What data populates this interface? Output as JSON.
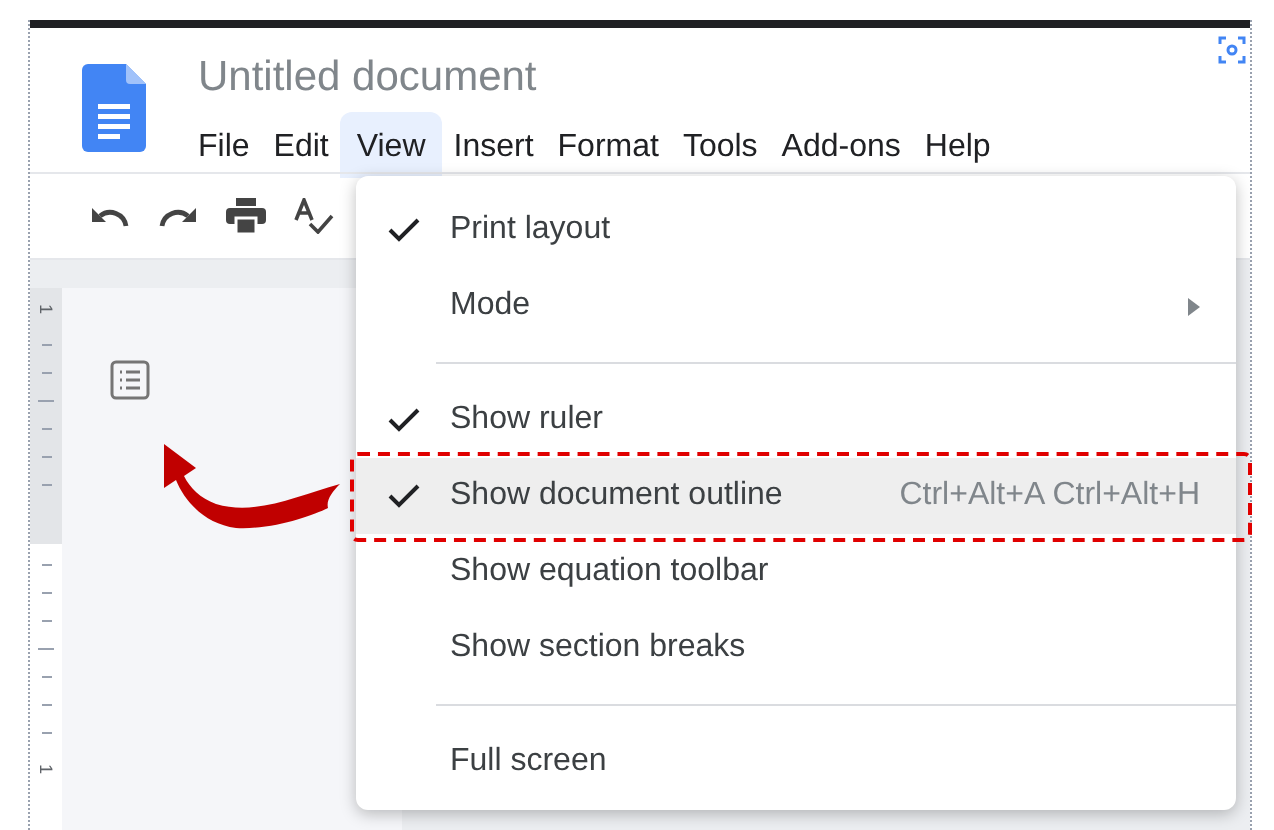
{
  "document": {
    "title": "Untitled document"
  },
  "menu_bar": [
    {
      "label": "File",
      "selected": false
    },
    {
      "label": "Edit",
      "selected": false
    },
    {
      "label": "View",
      "selected": true
    },
    {
      "label": "Insert",
      "selected": false
    },
    {
      "label": "Format",
      "selected": false
    },
    {
      "label": "Tools",
      "selected": false
    },
    {
      "label": "Add-ons",
      "selected": false
    },
    {
      "label": "Help",
      "selected": false
    }
  ],
  "ruler": {
    "labels": [
      "1",
      "1"
    ]
  },
  "view_menu": {
    "items": [
      {
        "kind": "item",
        "label": "Print layout",
        "checked": true,
        "highlighted": false
      },
      {
        "kind": "submenu",
        "label": "Mode",
        "checked": false,
        "highlighted": false
      },
      {
        "kind": "divider"
      },
      {
        "kind": "item",
        "label": "Show ruler",
        "checked": true,
        "highlighted": false
      },
      {
        "kind": "item",
        "label": "Show document outline",
        "checked": true,
        "highlighted": true,
        "shortcut": "Ctrl+Alt+A Ctrl+Alt+H"
      },
      {
        "kind": "item",
        "label": "Show equation toolbar",
        "checked": false,
        "highlighted": false
      },
      {
        "kind": "item",
        "label": "Show section breaks",
        "checked": false,
        "highlighted": false
      },
      {
        "kind": "divider"
      },
      {
        "kind": "item",
        "label": "Full screen",
        "checked": false,
        "highlighted": false
      }
    ]
  }
}
